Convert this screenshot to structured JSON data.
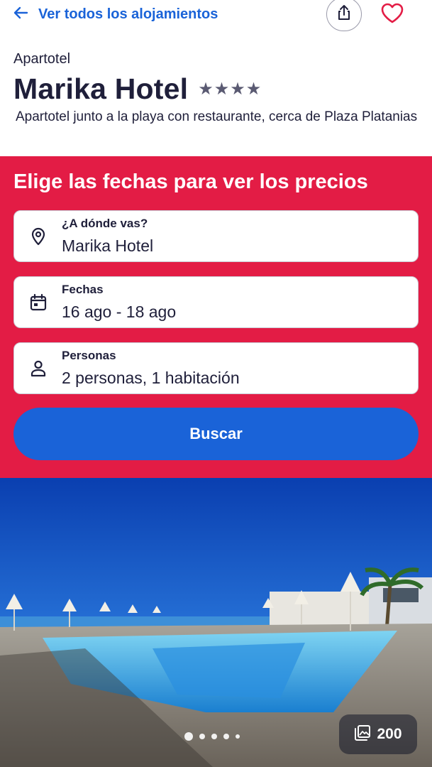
{
  "nav": {
    "back_label": "Ver todos los alojamientos",
    "accent_color": "#1a63d8"
  },
  "property": {
    "type": "Apartotel",
    "name": "Marika Hotel",
    "stars": "★★★★",
    "star_rating": 4,
    "description": "Apartotel junto a la playa con restaurante, cerca de Plaza Platanias"
  },
  "search": {
    "heading": "Elige las fechas para ver los precios",
    "panel_color": "#e31c45",
    "destination": {
      "label": "¿A dónde vas?",
      "value": "Marika Hotel",
      "icon": "location-pin-icon"
    },
    "dates": {
      "label": "Fechas",
      "value": "16 ago - 18 ago",
      "icon": "calendar-icon"
    },
    "guests": {
      "label": "Personas",
      "value": "2 personas, 1 habitación",
      "icon": "person-icon"
    },
    "button_label": "Buscar"
  },
  "gallery": {
    "photo_count": "200",
    "current_slide": 1,
    "visible_dots": 5,
    "icon": "gallery-icon"
  }
}
